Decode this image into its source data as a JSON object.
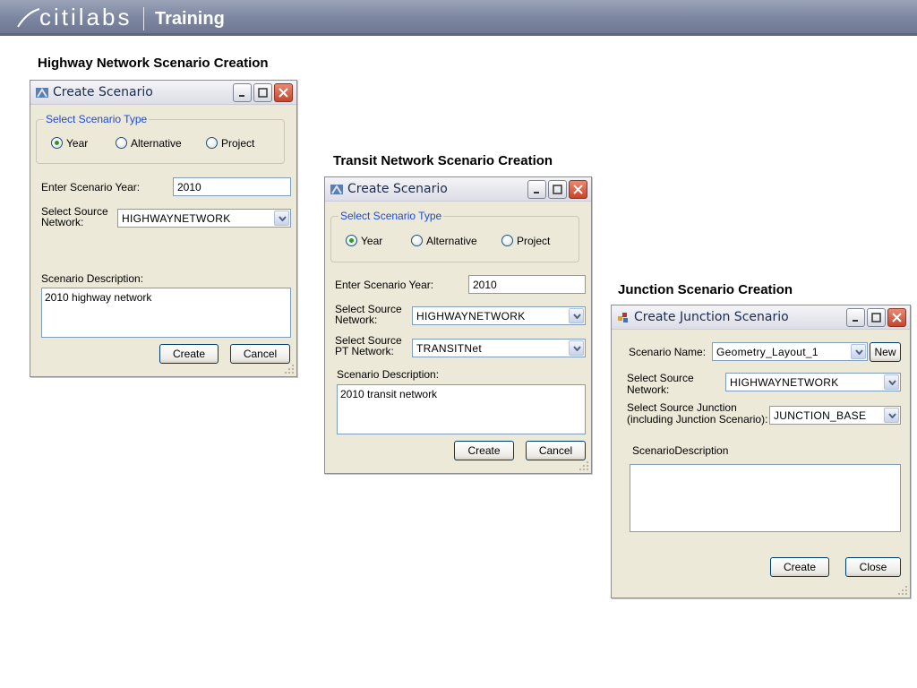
{
  "header": {
    "brand": "citilabs",
    "section": "Training"
  },
  "captions": {
    "highway": "Highway Network Scenario Creation",
    "transit": "Transit Network Scenario Creation",
    "junction": "Junction Scenario Creation"
  },
  "highway_dialog": {
    "title": "Create Scenario",
    "group_label": "Select Scenario Type",
    "radio_year": "Year",
    "radio_alternative": "Alternative",
    "radio_project": "Project",
    "selected_type": "Year",
    "year_label": "Enter Scenario Year:",
    "year_value": "2010",
    "network_label_1": "Select  Source",
    "network_label_2": "Network:",
    "network_value": "HIGHWAYNETWORK",
    "description_label": "Scenario Description:",
    "description_value": "2010 highway network",
    "create_button": "Create",
    "cancel_button": "Cancel"
  },
  "transit_dialog": {
    "title": "Create Scenario",
    "group_label": "Select Scenario Type",
    "radio_year": "Year",
    "radio_alternative": "Alternative",
    "radio_project": "Project",
    "selected_type": "Year",
    "year_label": "Enter Scenario Year:",
    "year_value": "2010",
    "network_label_1": "Select  Source",
    "network_label_2": "Network:",
    "network_value": "HIGHWAYNETWORK",
    "pt_label_1": "Select  Source",
    "pt_label_2": "PT Network:",
    "pt_value": "TRANSITNet",
    "description_label": "Scenario Description:",
    "description_value": "2010 transit network",
    "create_button": "Create",
    "cancel_button": "Cancel"
  },
  "junction_dialog": {
    "title": "Create Junction Scenario",
    "name_label": "Scenario Name:",
    "name_value": "Geometry_Layout_1",
    "new_button": "New",
    "network_label_1": "Select  Source",
    "network_label_2": "Network:",
    "network_value": "HIGHWAYNETWORK",
    "junction_label_1": "Select  Source  Junction",
    "junction_label_2": "(including Junction Scenario):",
    "junction_value": "JUNCTION_BASE",
    "description_label": "ScenarioDescription",
    "description_value": "",
    "create_button": "Create",
    "close_button": "Close"
  },
  "icons": {
    "minimize": "minimize-icon",
    "maximize": "maximize-icon",
    "close": "close-icon",
    "dropdown": "chevron-down-icon"
  },
  "colors": {
    "banner": "#7c86a0",
    "legend_text": "#1a4bd8",
    "close_button": "#c6462c",
    "dialog_bg": "#ece9d8"
  }
}
